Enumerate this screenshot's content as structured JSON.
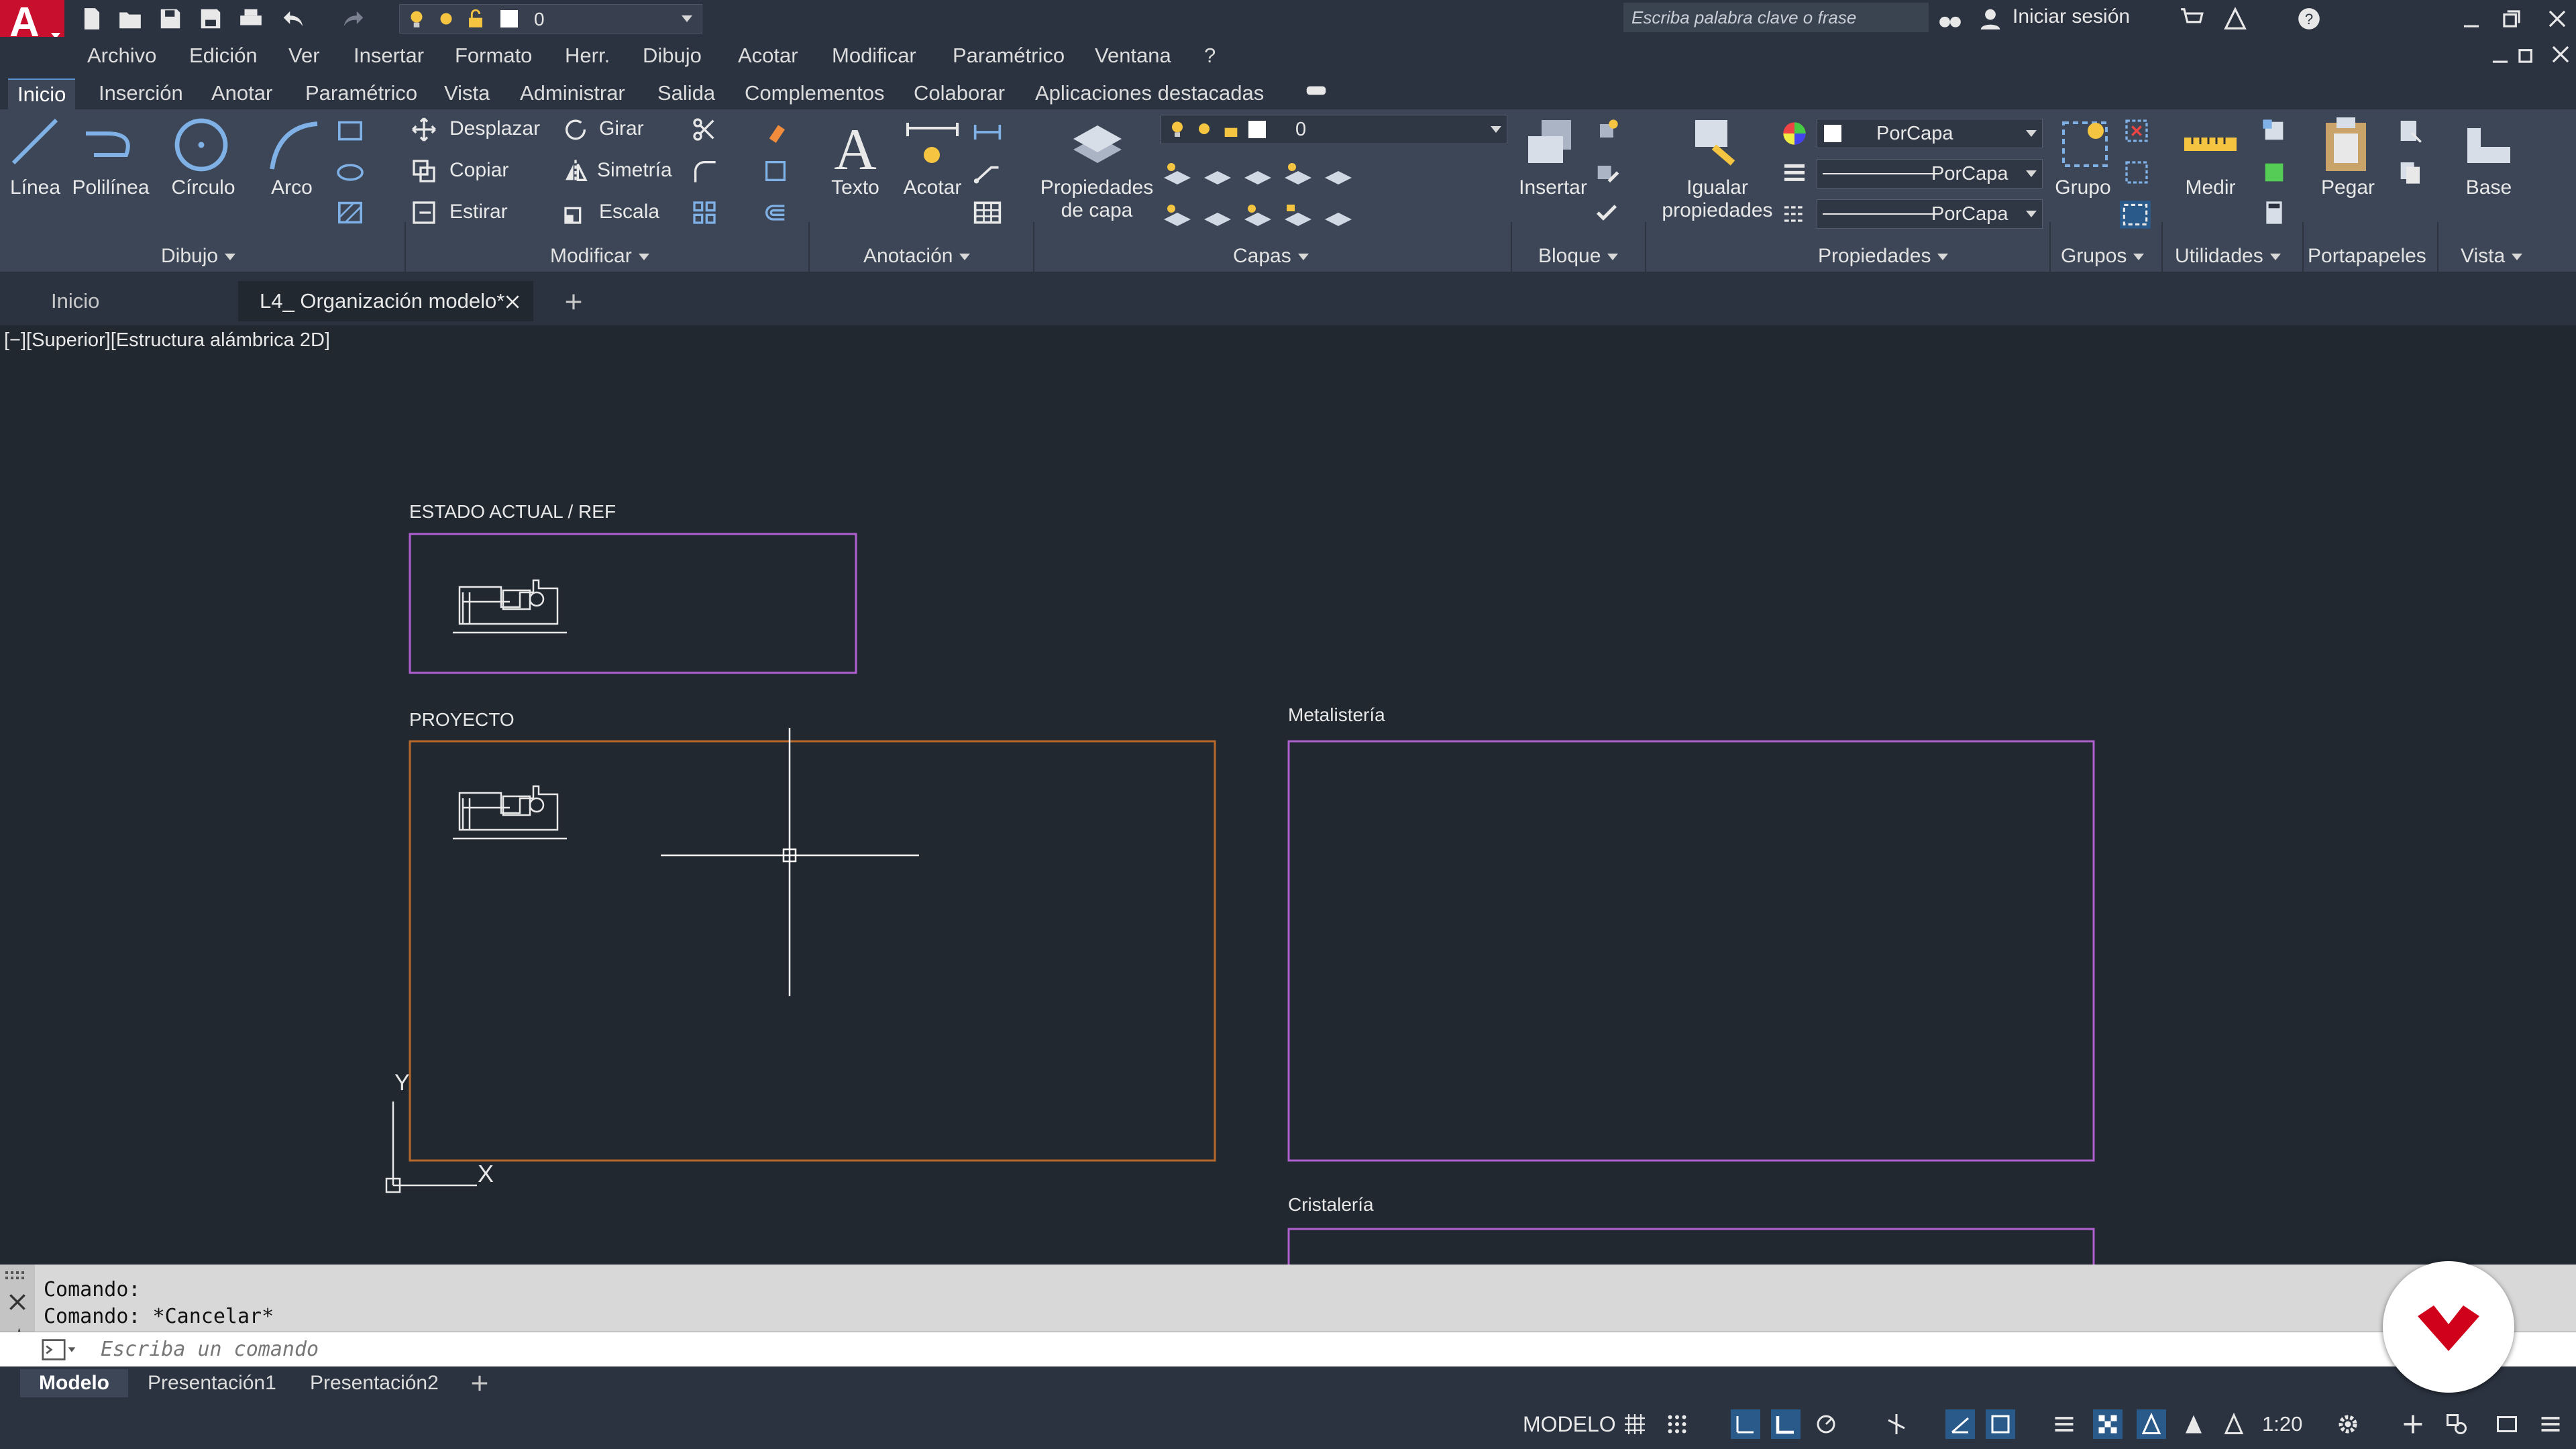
{
  "app": {
    "logo_letter": "A"
  },
  "quick_access": {
    "layer_value": "0"
  },
  "search": {
    "placeholder": "Escriba palabra clave o frase"
  },
  "account": {
    "signin": "Iniciar sesión"
  },
  "menubar": [
    "Archivo",
    "Edición",
    "Ver",
    "Insertar",
    "Formato",
    "Herr.",
    "Dibujo",
    "Acotar",
    "Modificar",
    "Paramétrico",
    "Ventana",
    "?"
  ],
  "ribbon_tabs": [
    "Inicio",
    "Inserción",
    "Anotar",
    "Paramétrico",
    "Vista",
    "Administrar",
    "Salida",
    "Complementos",
    "Colaborar",
    "Aplicaciones destacadas"
  ],
  "ribbon": {
    "draw": {
      "line": "Línea",
      "polyline": "Polilínea",
      "circle": "Círculo",
      "arc": "Arco",
      "title": "Dibujo"
    },
    "modify": {
      "move": "Desplazar",
      "rotate": "Girar",
      "copy": "Copiar",
      "mirror": "Simetría",
      "stretch": "Estirar",
      "scale": "Escala",
      "title": "Modificar"
    },
    "annotation": {
      "text": "Texto",
      "dimension": "Acotar",
      "title": "Anotación"
    },
    "layers": {
      "props_line1": "Propiedades",
      "props_line2": "de capa",
      "current": "0",
      "title": "Capas"
    },
    "block": {
      "insert": "Insertar",
      "title": "Bloque"
    },
    "properties": {
      "match_line1": "Igualar",
      "match_line2": "propiedades",
      "color": "PorCapa",
      "lineweight": "PorCapa",
      "linetype": "PorCapa",
      "title": "Propiedades"
    },
    "groups": {
      "group": "Grupo",
      "title": "Grupos"
    },
    "utilities": {
      "measure": "Medir",
      "title": "Utilidades"
    },
    "clipboard": {
      "paste": "Pegar",
      "title": "Portapapeles"
    },
    "view": {
      "base": "Base",
      "title": "Vista"
    }
  },
  "doc_tabs": {
    "home": "Inicio",
    "active": "L4_ Organización modelo*"
  },
  "viewport": {
    "label": "[−][Superior][Estructura alámbrica 2D]"
  },
  "drawing": {
    "frame1_label": "ESTADO ACTUAL / REF",
    "frame2_label": "PROYECTO",
    "frame3_label": "Metalistería",
    "frame4_label": "Cristalería",
    "ucs_x": "X",
    "ucs_y": "Y"
  },
  "command": {
    "line1": "Comando:",
    "line2": "Comando: *Cancelar*",
    "placeholder": "Escriba un comando"
  },
  "layout_tabs": [
    "Modelo",
    "Presentación1",
    "Presentación2"
  ],
  "statusbar": {
    "mode": "MODELO",
    "scale": "1:20"
  },
  "colors": {
    "accent": "#2a5a8a",
    "logo": "#c8102e",
    "frame_purple": "#b05fd0",
    "frame_orange": "#b8682a",
    "brand_red": "#d0021b"
  }
}
